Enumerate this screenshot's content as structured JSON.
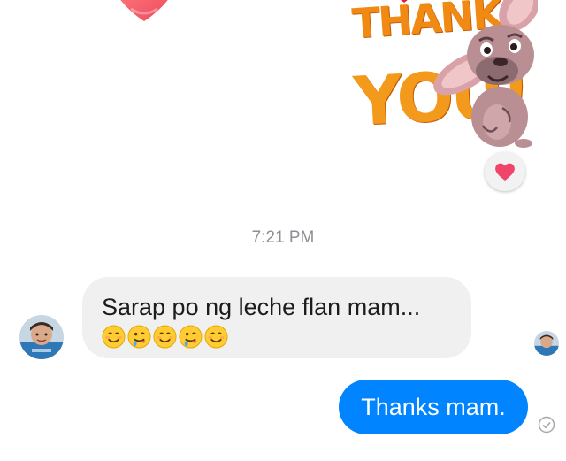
{
  "conversation": {
    "sticker": {
      "line1": "THANK",
      "line2": "YOU!"
    },
    "reaction_icon": "heart-icon",
    "timestamp": "7:21 PM",
    "incoming": {
      "text": "Sarap po ng leche flan mam...",
      "emojis": [
        "smiling-face-icon",
        "savoring-food-face-icon",
        "smiling-face-icon",
        "savoring-food-face-icon",
        "smiling-face-icon"
      ]
    },
    "outgoing": {
      "text": "Thanks mam."
    },
    "status_icon": "sent-check-icon"
  },
  "colors": {
    "outgoing_bubble": "#0084ff",
    "incoming_bubble": "#f1f0f0",
    "reaction_heart": "#f0446a",
    "timestamp": "#8e8e93",
    "sticker_orange": "#f08a12"
  }
}
